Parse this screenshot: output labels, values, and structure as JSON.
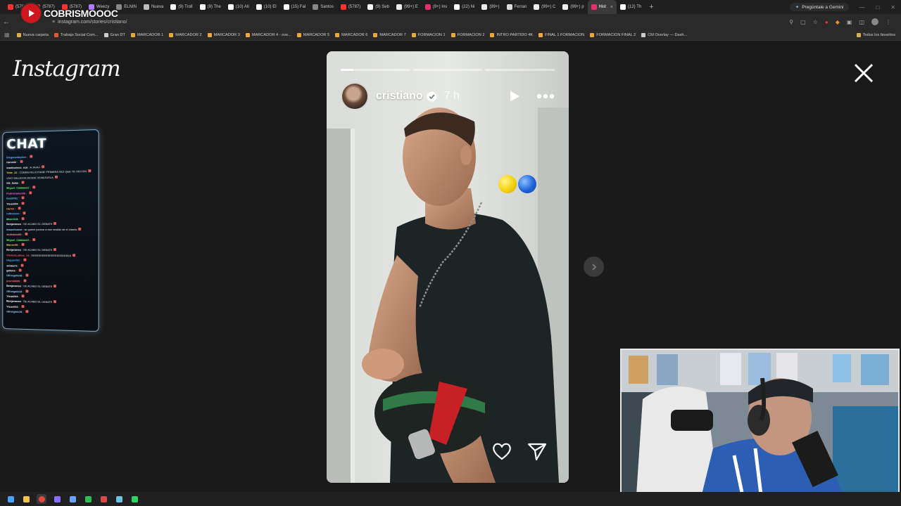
{
  "browser": {
    "tabs": [
      {
        "label": "(5787)",
        "color": "#ff3030"
      },
      {
        "label": "(5787)",
        "color": "#ff3030"
      },
      {
        "label": "(5787)",
        "color": "#ff3030"
      },
      {
        "label": "Weezy",
        "color": "#b07cff"
      },
      {
        "label": "ELNIN",
        "color": "#888888"
      },
      {
        "label": "Nueva",
        "color": "#bbbbbb"
      },
      {
        "label": "(9) Troll",
        "color": "#ffffff"
      },
      {
        "label": "(9) The",
        "color": "#ffffff"
      },
      {
        "label": "(10) Ati",
        "color": "#ffffff"
      },
      {
        "label": "(10) El",
        "color": "#ffffff"
      },
      {
        "label": "(15) Fal",
        "color": "#ffffff"
      },
      {
        "label": "Santos",
        "color": "#888888"
      },
      {
        "label": "(5787)",
        "color": "#ff3030"
      },
      {
        "label": "(9) Seb",
        "color": "#ffffff"
      },
      {
        "label": "(99+) E",
        "color": "#eeeeee"
      },
      {
        "label": "(9+) Ins",
        "color": "#e1306c"
      },
      {
        "label": "(22) Ni",
        "color": "#ffffff"
      },
      {
        "label": "(99+)",
        "color": "#eeeeee"
      },
      {
        "label": "Ferran",
        "color": "#dddddd"
      },
      {
        "label": "(99+) C",
        "color": "#eeeeee"
      },
      {
        "label": "(99+) p",
        "color": "#eeeeee"
      },
      {
        "label": "Hist",
        "color": "#e1306c",
        "active": true
      },
      {
        "label": "(12) Th",
        "color": "#ffffff"
      }
    ],
    "gemini_label": "Pregúntale a Gemini",
    "url": "instagram.com/stories/cristiano/",
    "bookmarks": [
      {
        "label": "Nueva carpeta",
        "color": "#d9b24c"
      },
      {
        "label": "Trabajo Social Com...",
        "color": "#e05a3a"
      },
      {
        "label": "Gran DT",
        "color": "#cccccc"
      },
      {
        "label": "MARCADOR 1",
        "color": "#e8a93a"
      },
      {
        "label": "MARCADOR 2",
        "color": "#e8a93a"
      },
      {
        "label": "MARCADOR 3",
        "color": "#e8a93a"
      },
      {
        "label": "MARCADOR 4 - ove...",
        "color": "#e8a93a"
      },
      {
        "label": "MARCADOR 5",
        "color": "#e8a93a"
      },
      {
        "label": "MARCADOR 6",
        "color": "#e8a93a"
      },
      {
        "label": "MARCADOR 7",
        "color": "#e8a93a"
      },
      {
        "label": "FORMACION 1",
        "color": "#e8a93a"
      },
      {
        "label": "FORMACION 2",
        "color": "#e8a93a"
      },
      {
        "label": "INTRO PARTIDO 4K",
        "color": "#e8a93a"
      },
      {
        "label": "FINAL 1 FORMACION",
        "color": "#e8a93a"
      },
      {
        "label": "FORMACION FINAL 2",
        "color": "#e8a93a"
      },
      {
        "label": "CM Overlay — Dash...",
        "color": "#cccccc"
      }
    ],
    "all_bookmarks": "Todos los favoritos"
  },
  "stream": {
    "channel_name": "COBRISMOOOC"
  },
  "instagram": {
    "logo": "Instagram",
    "story": {
      "username": "cristiano",
      "time": "7 h",
      "progress": [
        0.18,
        0,
        0
      ]
    }
  },
  "chat": {
    "title": "CHAT",
    "messages": [
      {
        "user": "Elegancitaydos",
        "text": "",
        "color": "#6ab0ff"
      },
      {
        "user": "rbrn442",
        "text": "",
        "color": "#ffffff"
      },
      {
        "user": "martincinco_ruiz",
        "text": "A JAJAJ",
        "color": "#ffffff"
      },
      {
        "user": "Yebe_22",
        "text": "COBRA FELICITAME PRIMERA VEZ QUE TE VEO EN",
        "color": "#ffdd55"
      },
      {
        "user": "",
        "text": "VIVO SALUDOS DESDE VENEZUELA",
        "color": "#ffffff"
      },
      {
        "user": "GS_Seba",
        "text": "",
        "color": "#ffffff"
      },
      {
        "user": "Miguel_Catalan22",
        "text": "",
        "color": "#66ff66"
      },
      {
        "user": "PedroCarlos96",
        "text": "",
        "color": "#ff66cc"
      },
      {
        "user": "Ines0761",
        "text": "",
        "color": "#66ccff"
      },
      {
        "user": "Yisus044",
        "text": "",
        "color": "#ffffff"
      },
      {
        "user": "Hurtel",
        "text": "",
        "color": "#ff9955"
      },
      {
        "user": "rolfedoom",
        "text": "",
        "color": "#6ab0ff"
      },
      {
        "user": "Miaer028",
        "text": "",
        "color": "#66ff99"
      },
      {
        "user": "Benjaranoo",
        "text": "SE ACABO EL DEBATE",
        "color": "#ffffff"
      },
      {
        "user": "mauchicano",
        "text": "se quiere ponear a ese vestido de el cheeto",
        "color": "#99ccff"
      },
      {
        "user": "elotedurc60",
        "text": "",
        "color": "#ff9999"
      },
      {
        "user": "Miguel_Catalan22",
        "text": "",
        "color": "#66ff66"
      },
      {
        "user": "Manne90",
        "text": "",
        "color": "#ffcc66"
      },
      {
        "user": "Benjaranoo",
        "text": "SE ACABO EL DEBATE",
        "color": "#ffffff"
      },
      {
        "user": "VilchesLuthos_14",
        "text": "EEEEEEEEEEEEEEEEEEEEEE",
        "color": "#ff5555"
      },
      {
        "user": "Hoppert92",
        "text": "",
        "color": "#55aaff"
      },
      {
        "user": "sebaurlx",
        "text": "",
        "color": "#ffffff"
      },
      {
        "user": "gafoho",
        "text": "",
        "color": "#ffffff"
      },
      {
        "user": "GEnegato18",
        "text": "",
        "color": "#99ccff"
      },
      {
        "user": "pronti8889",
        "text": "",
        "color": "#ff6666"
      },
      {
        "user": "Benjaranoo",
        "text": "SE ACABO EL DEBATE",
        "color": "#ffffff"
      },
      {
        "user": "GEnegato18",
        "text": "",
        "color": "#99ccff"
      },
      {
        "user": "Yisus044",
        "text": "",
        "color": "#ffffff"
      },
      {
        "user": "Benjaranoo",
        "text": "SE ACABO EL DEBATE",
        "color": "#ffffff"
      },
      {
        "user": "Yisus044",
        "text": "",
        "color": "#ffffff"
      },
      {
        "user": "GEnegato18",
        "text": "",
        "color": "#99ccff"
      }
    ]
  },
  "taskbar": {
    "apps": [
      {
        "name": "windows-start-icon",
        "color": "#4aa3ff"
      },
      {
        "name": "file-explorer-icon",
        "color": "#f2c14e"
      },
      {
        "name": "chrome-icon",
        "color": "#e8453c",
        "active": true
      },
      {
        "name": "app-grid-icon",
        "color": "#8a6cff"
      },
      {
        "name": "browser-app-icon",
        "color": "#6aa0ff"
      },
      {
        "name": "xbox-icon",
        "color": "#2fbf4f"
      },
      {
        "name": "obs-icon",
        "color": "#d84a4a"
      },
      {
        "name": "app-icon",
        "color": "#6fc3e0"
      },
      {
        "name": "chat-app-icon",
        "color": "#2ed06a"
      }
    ]
  },
  "colors": {
    "background": "#1a1a1a",
    "instagram_text": "#f5f5f5",
    "story_accent_yellow": "#f5d10a",
    "story_accent_blue": "#1e64d8"
  }
}
